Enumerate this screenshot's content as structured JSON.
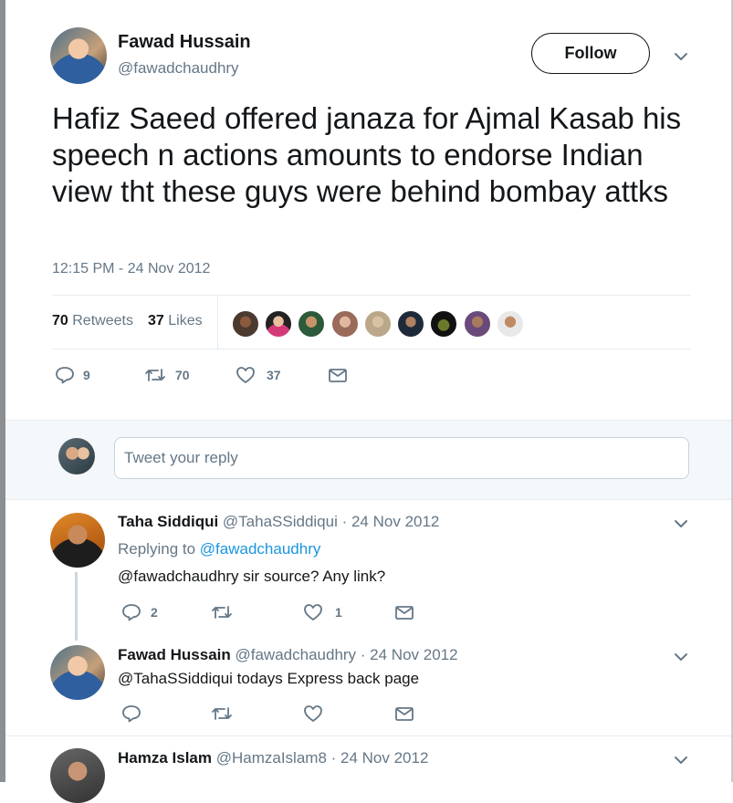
{
  "tweet": {
    "author_name": "Fawad Hussain",
    "author_handle": "@fawadchaudhry",
    "follow_label": "Follow",
    "text": "Hafiz Saeed offered janaza for Ajmal Kasab his speech n actions amounts to endorse Indian view tht these guys were behind bombay attks",
    "timestamp": "12:15 PM - 24 Nov 2012",
    "retweets_count": "70",
    "retweets_label": "Retweets",
    "likes_count": "37",
    "likes_label": "Likes",
    "actions": {
      "reply_count": "9",
      "retweet_count": "70",
      "like_count": "37"
    }
  },
  "reply_composer": {
    "placeholder": "Tweet your reply"
  },
  "replies": [
    {
      "name": "Taha Siddiqui",
      "handle_date": "@TahaSSiddiqui · 24 Nov 2012",
      "replying_prefix": "Replying to",
      "replying_handle": "@fawadchaudhry",
      "text": "@fawadchaudhry sir source? Any link?",
      "reply_count": "2",
      "retweet_count": "",
      "like_count": "1"
    },
    {
      "name": "Fawad Hussain",
      "handle_date": "@fawadchaudhry · 24 Nov 2012",
      "text": "@TahaSSiddiqui todays Express back page",
      "reply_count": "",
      "retweet_count": "",
      "like_count": ""
    },
    {
      "name": "Hamza Islam",
      "handle_date": "@HamzaIslam8 · 24 Nov 2012"
    }
  ],
  "colors": {
    "accent": "#1b95e0",
    "text": "#14171a",
    "muted": "#657786"
  },
  "icons": [
    "chevron-down-icon",
    "reply-icon",
    "retweet-icon",
    "heart-icon",
    "message-icon"
  ]
}
